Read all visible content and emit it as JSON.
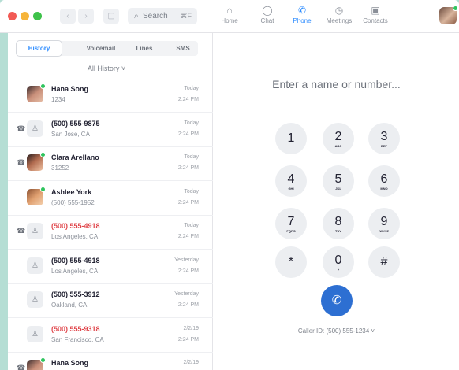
{
  "toolbar": {
    "search_placeholder": "Search",
    "search_shortcut": "⌘F",
    "nav": [
      {
        "label": "Home",
        "icon": "home-icon",
        "glyph": "⌂"
      },
      {
        "label": "Chat",
        "icon": "chat-icon",
        "glyph": "◯"
      },
      {
        "label": "Phone",
        "icon": "phone-icon",
        "glyph": "✆"
      },
      {
        "label": "Meetings",
        "icon": "clock-icon",
        "glyph": "◷"
      },
      {
        "label": "Contacts",
        "icon": "contacts-icon",
        "glyph": "▣"
      }
    ],
    "active_nav": "Phone"
  },
  "tabs": [
    {
      "label": "History",
      "active": true
    },
    {
      "label": "Voicemail",
      "active": false
    },
    {
      "label": "Lines",
      "active": false
    },
    {
      "label": "SMS",
      "active": false
    }
  ],
  "filter_label": "All History ˅",
  "history": [
    {
      "name": "Hana Song",
      "sub": "1234",
      "date": "Today",
      "time": "2:24 PM",
      "missed": false,
      "avatar": "photo",
      "online": true,
      "voicemail": false
    },
    {
      "name": "(500) 555-9875",
      "sub": "San Jose, CA",
      "date": "Today",
      "time": "2:24 PM",
      "missed": false,
      "avatar": "generic",
      "online": false,
      "voicemail": true
    },
    {
      "name": "Clara Arellano",
      "sub": "31252",
      "date": "Today",
      "time": "2:24 PM",
      "missed": false,
      "avatar": "photo",
      "online": true,
      "voicemail": true
    },
    {
      "name": "Ashlee York",
      "sub": "(500) 555-1952",
      "date": "Today",
      "time": "2:24 PM",
      "missed": false,
      "avatar": "photo",
      "online": true,
      "voicemail": false
    },
    {
      "name": "(500) 555-4918",
      "sub": "Los Angeles, CA",
      "date": "Today",
      "time": "2:24 PM",
      "missed": true,
      "avatar": "generic",
      "online": false,
      "voicemail": true
    },
    {
      "name": "(500) 555-4918",
      "sub": "Los Angeles, CA",
      "date": "Yesterday",
      "time": "2:24 PM",
      "missed": false,
      "avatar": "generic",
      "online": false,
      "voicemail": false
    },
    {
      "name": "(500) 555-3912",
      "sub": "Oakland, CA",
      "date": "Yesterday",
      "time": "2:24 PM",
      "missed": false,
      "avatar": "generic",
      "online": false,
      "voicemail": false
    },
    {
      "name": "(500) 555-9318",
      "sub": "San Francisco, CA",
      "date": "2/2/19",
      "time": "2:24 PM",
      "missed": true,
      "avatar": "generic",
      "online": false,
      "voicemail": false
    },
    {
      "name": "Hana Song",
      "sub": "",
      "date": "2/2/19",
      "time": "",
      "missed": false,
      "avatar": "photo",
      "online": true,
      "voicemail": true
    }
  ],
  "dialer": {
    "placeholder": "Enter a name or number...",
    "keys": [
      {
        "digit": "1",
        "letters": ""
      },
      {
        "digit": "2",
        "letters": "ABC"
      },
      {
        "digit": "3",
        "letters": "DEF"
      },
      {
        "digit": "4",
        "letters": "GHI"
      },
      {
        "digit": "5",
        "letters": "JKL"
      },
      {
        "digit": "6",
        "letters": "MNO"
      },
      {
        "digit": "7",
        "letters": "PQRS"
      },
      {
        "digit": "8",
        "letters": "TUV"
      },
      {
        "digit": "9",
        "letters": "WXYZ"
      },
      {
        "digit": "*",
        "letters": ""
      },
      {
        "digit": "0",
        "letters": "+"
      },
      {
        "digit": "#",
        "letters": ""
      }
    ],
    "caller_id": "Caller ID: (500) 555-1234 ˅"
  },
  "colors": {
    "accent": "#2d8cff",
    "call_button": "#2d6fd2",
    "missed": "#e0474c",
    "online": "#2ec45d",
    "background": "#b5ded4"
  }
}
